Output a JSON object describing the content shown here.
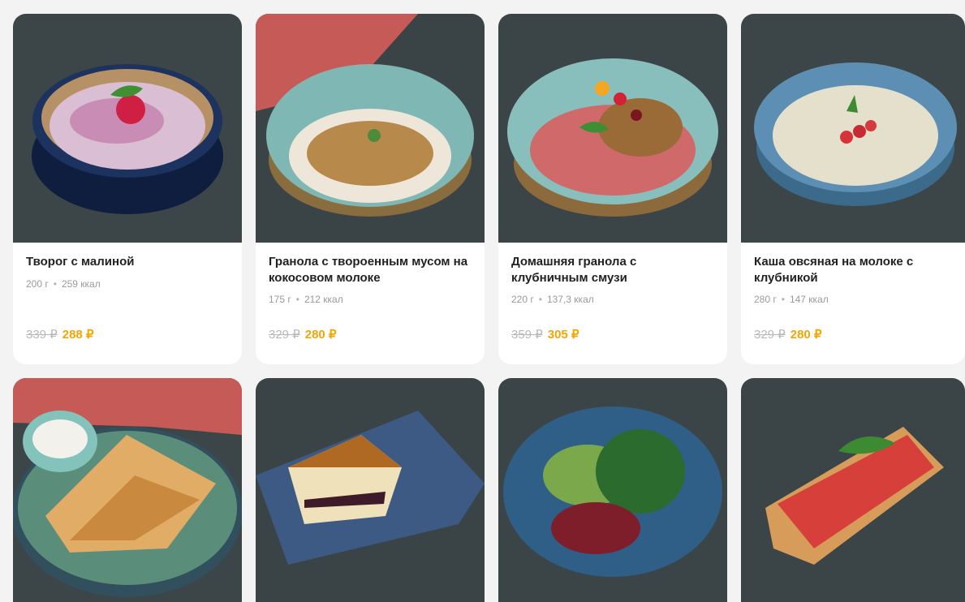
{
  "products": [
    {
      "name": "Творог с малиной",
      "weight": "200 г",
      "kcal": "259 ккал",
      "old_price": "339 ₽",
      "price": "288 ₽",
      "icon": "cottage-cheese-raspberry-photo"
    },
    {
      "name": "Гранола с твороенным мусом на кокосовом молоке",
      "weight": "175 г",
      "kcal": "212 ккал",
      "old_price": "329 ₽",
      "price": "280 ₽",
      "icon": "granola-coconut-photo"
    },
    {
      "name": "Домашняя гранола с клубничным смузи",
      "weight": "220 г",
      "kcal": "137,3 ккал",
      "old_price": "359 ₽",
      "price": "305 ₽",
      "icon": "granola-smoothie-photo"
    },
    {
      "name": "Каша овсяная на молоке с клубникой",
      "weight": "280 г",
      "kcal": "147 ккал",
      "old_price": "329 ₽",
      "price": "280 ₽",
      "icon": "oatmeal-strawberry-photo"
    },
    {
      "icon": "pancakes-photo"
    },
    {
      "icon": "casserole-photo"
    },
    {
      "icon": "salad-photo"
    },
    {
      "icon": "bruschetta-photo"
    }
  ],
  "colors": {
    "accent": "#f5a500",
    "muted": "#9a9a9a",
    "text": "#222222"
  }
}
